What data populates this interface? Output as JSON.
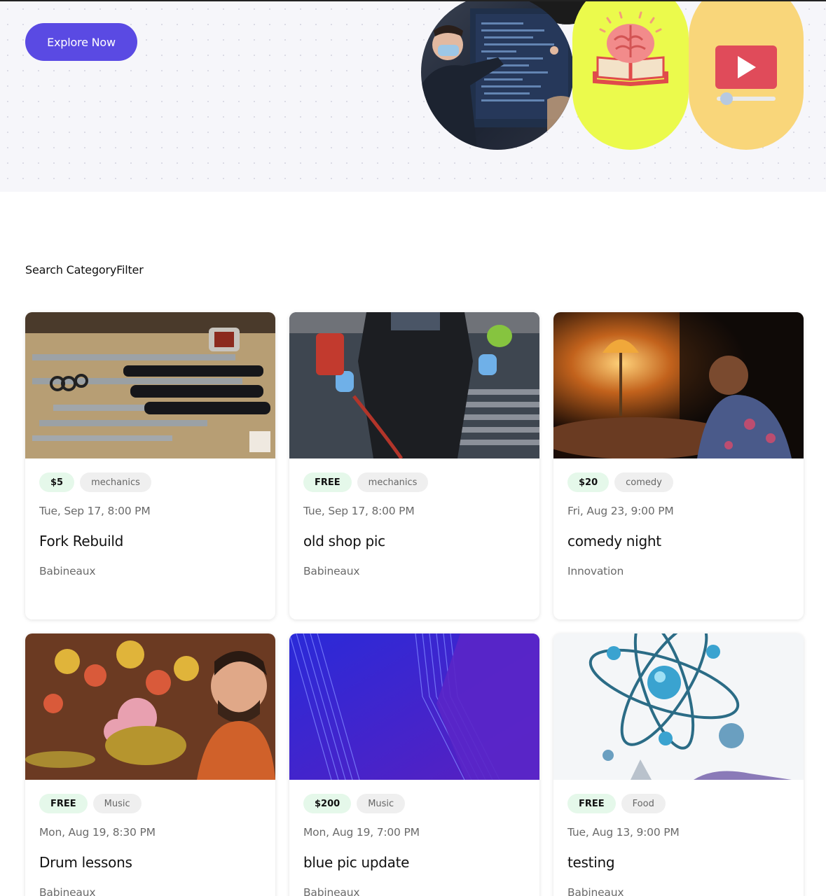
{
  "hero": {
    "cta_label": "Explore Now",
    "tiles": [
      {
        "icon": "presenter-photo"
      },
      {
        "icon": "brain-book-icon",
        "color": "#ebfa4c"
      },
      {
        "icon": "video-player-icon",
        "color": "#f9d67a"
      }
    ]
  },
  "filter": {
    "label": "Search CategoryFilter"
  },
  "events": [
    {
      "price": "$5",
      "category": "mechanics",
      "date": "Tue, Sep 17, 8:00 PM",
      "title": "Fork Rebuild",
      "venue": "Babineaux",
      "image": "fork-parts-photo"
    },
    {
      "price": "FREE",
      "category": "mechanics",
      "date": "Tue, Sep 17, 8:00 PM",
      "title": "old shop pic",
      "venue": "Babineaux",
      "image": "mechanic-photo"
    },
    {
      "price": "$20",
      "category": "comedy",
      "date": "Fri, Aug 23, 9:00 PM",
      "title": "comedy night",
      "venue": "Innovation",
      "image": "lamp-drink-photo"
    },
    {
      "price": "FREE",
      "category": "Music",
      "date": "Mon, Aug 19, 8:30 PM",
      "title": "Drum lessons",
      "venue": "Babineaux",
      "image": "drummer-photo"
    },
    {
      "price": "$200",
      "category": "Music",
      "date": "Mon, Aug 19, 7:00 PM",
      "title": "blue pic update",
      "venue": "Babineaux",
      "image": "blue-abstract-image"
    },
    {
      "price": "FREE",
      "category": "Food",
      "date": "Tue, Aug 13, 9:00 PM",
      "title": "testing",
      "venue": "Babineaux",
      "image": "atom-illustration"
    }
  ],
  "colors": {
    "accent": "#5a4ae3",
    "price_badge_bg": "#e5f8ea",
    "category_badge_bg": "#efefef",
    "hero_bg": "#f6f6fa"
  }
}
